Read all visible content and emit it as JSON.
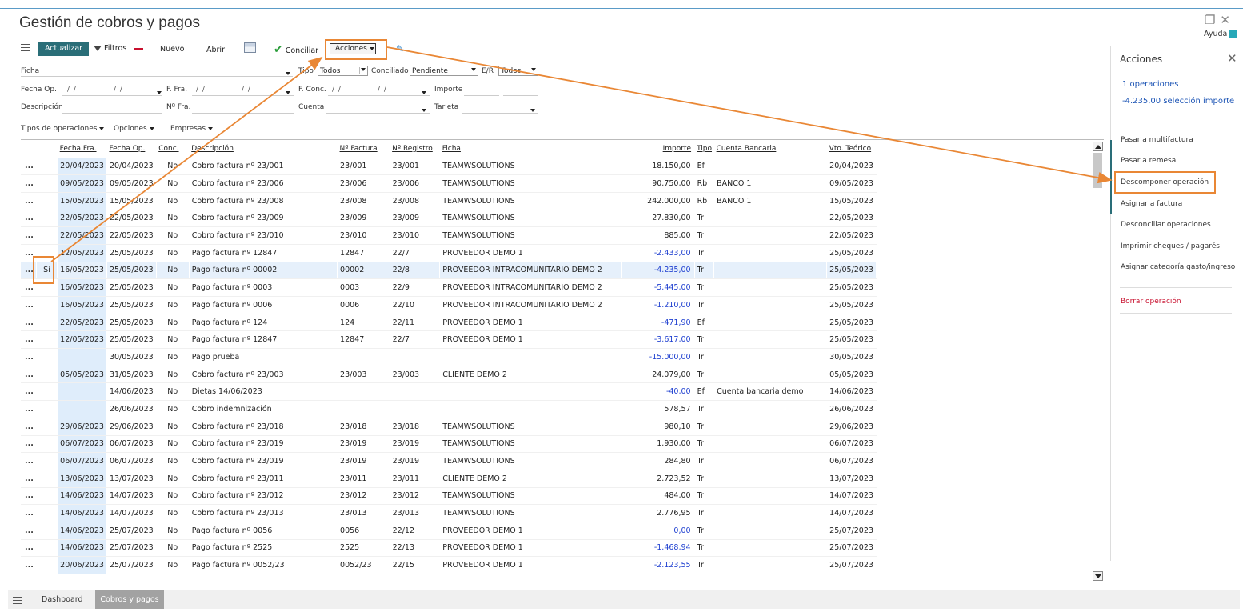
{
  "app": {
    "title": "Gestión de cobros y pagos",
    "help": "Ayuda"
  },
  "toolbar": {
    "actualizar": "Actualizar",
    "filtros": "Filtros",
    "nuevo": "Nuevo",
    "abrir": "Abrir",
    "conciliar": "Conciliar",
    "acciones": "Acciones"
  },
  "filters": {
    "ficha_label": "Ficha",
    "tipo_label": "Tipo",
    "tipo_value": "Todos",
    "conciliado_label": "Conciliado",
    "conciliado_value": "Pendiente",
    "er_label": "E/R",
    "er_value": "Todos",
    "fecha_op_label": "Fecha Op.",
    "fecha_fra_label": "F. Fra.",
    "f_conc_label": "F. Conc.",
    "importe_label": "Importe",
    "date_placeholder": "/ /",
    "descripcion_label": "Descripción",
    "nfra_label": "Nº Fra.",
    "cuenta_label": "Cuenta",
    "tarjeta_label": "Tarjeta",
    "dropdowns": [
      "Tipos de operaciones",
      "Opciones",
      "Empresas"
    ]
  },
  "table": {
    "headers": {
      "fecha_fra": "Fecha Fra.",
      "fecha_op": "Fecha Op.",
      "conc": "Conc.",
      "descripcion": "Descripción",
      "n_factura": "Nº Factura",
      "n_registro": "Nº Registro",
      "ficha": "Ficha",
      "importe": "Importe",
      "tipo": "Tipo",
      "cuenta_bancaria": "Cuenta Bancaria",
      "vto_teorico": "Vto. Teórico"
    },
    "rows": [
      {
        "dots": "...",
        "sel": "",
        "fra": "20/04/2023",
        "op": "20/04/2023",
        "conc": "No",
        "desc": "Cobro factura nº 23/001",
        "nfac": "23/001",
        "nreg": "23/001",
        "ficha": "TEAMWSOLUTIONS",
        "imp": "18.150,00",
        "tipo": "Ef",
        "cuenta": "",
        "vto": "20/04/2023"
      },
      {
        "dots": "...",
        "sel": "",
        "fra": "09/05/2023",
        "op": "09/05/2023",
        "conc": "No",
        "desc": "Cobro factura nº 23/006",
        "nfac": "23/006",
        "nreg": "23/006",
        "ficha": "TEAMWSOLUTIONS",
        "imp": "90.750,00",
        "tipo": "Rb",
        "cuenta": "BANCO 1",
        "vto": "09/05/2023"
      },
      {
        "dots": "...",
        "sel": "",
        "fra": "15/05/2023",
        "op": "15/05/2023",
        "conc": "No",
        "desc": "Cobro factura nº 23/008",
        "nfac": "23/008",
        "nreg": "23/008",
        "ficha": "TEAMWSOLUTIONS",
        "imp": "242.000,00",
        "tipo": "Rb",
        "cuenta": "BANCO 1",
        "vto": "15/05/2023"
      },
      {
        "dots": "...",
        "sel": "",
        "fra": "22/05/2023",
        "op": "22/05/2023",
        "conc": "No",
        "desc": "Cobro factura nº 23/009",
        "nfac": "23/009",
        "nreg": "23/009",
        "ficha": "TEAMWSOLUTIONS",
        "imp": "27.830,00",
        "tipo": "Tr",
        "cuenta": "",
        "vto": "22/05/2023"
      },
      {
        "dots": "...",
        "sel": "",
        "fra": "22/05/2023",
        "op": "22/05/2023",
        "conc": "No",
        "desc": "Cobro factura nº 23/010",
        "nfac": "23/010",
        "nreg": "23/010",
        "ficha": "TEAMWSOLUTIONS",
        "imp": "885,00",
        "tipo": "Tr",
        "cuenta": "",
        "vto": "22/05/2023"
      },
      {
        "dots": "...",
        "sel": "",
        "fra": "12/05/2023",
        "op": "25/05/2023",
        "conc": "No",
        "desc": "Pago factura nº 12847",
        "nfac": "12847",
        "nreg": "22/7",
        "ficha": "PROVEEDOR DEMO 1",
        "imp": "-2.433,00",
        "tipo": "Tr",
        "cuenta": "",
        "vto": "25/05/2023"
      },
      {
        "dots": "...",
        "sel": "Si",
        "fra": "16/05/2023",
        "op": "25/05/2023",
        "conc": "No",
        "desc": "Pago factura nº 00002",
        "nfac": "00002",
        "nreg": "22/8",
        "ficha": "PROVEEDOR INTRACOMUNITARIO DEMO 2",
        "imp": "-4.235,00",
        "tipo": "Tr",
        "cuenta": "",
        "vto": "25/05/2023"
      },
      {
        "dots": "...",
        "sel": "",
        "fra": "16/05/2023",
        "op": "25/05/2023",
        "conc": "No",
        "desc": "Pago factura nº 0003",
        "nfac": "0003",
        "nreg": "22/9",
        "ficha": "PROVEEDOR INTRACOMUNITARIO DEMO 2",
        "imp": "-5.445,00",
        "tipo": "Tr",
        "cuenta": "",
        "vto": "25/05/2023"
      },
      {
        "dots": "...",
        "sel": "",
        "fra": "16/05/2023",
        "op": "25/05/2023",
        "conc": "No",
        "desc": "Pago factura nº 0006",
        "nfac": "0006",
        "nreg": "22/10",
        "ficha": "PROVEEDOR INTRACOMUNITARIO DEMO 2",
        "imp": "-1.210,00",
        "tipo": "Tr",
        "cuenta": "",
        "vto": "25/05/2023"
      },
      {
        "dots": "...",
        "sel": "",
        "fra": "22/05/2023",
        "op": "25/05/2023",
        "conc": "No",
        "desc": "Pago factura nº 124",
        "nfac": "124",
        "nreg": "22/11",
        "ficha": "PROVEEDOR DEMO 1",
        "imp": "-471,90",
        "tipo": "Ef",
        "cuenta": "",
        "vto": "25/05/2023"
      },
      {
        "dots": "...",
        "sel": "",
        "fra": "12/05/2023",
        "op": "25/05/2023",
        "conc": "No",
        "desc": "Pago factura nº 12847",
        "nfac": "12847",
        "nreg": "22/7",
        "ficha": "PROVEEDOR DEMO 1",
        "imp": "-3.617,00",
        "tipo": "Tr",
        "cuenta": "",
        "vto": "25/05/2023"
      },
      {
        "dots": "...",
        "sel": "",
        "fra": "",
        "op": "30/05/2023",
        "conc": "No",
        "desc": "Pago prueba",
        "nfac": "",
        "nreg": "",
        "ficha": "",
        "imp": "-15.000,00",
        "tipo": "Tr",
        "cuenta": "",
        "vto": "30/05/2023"
      },
      {
        "dots": "...",
        "sel": "",
        "fra": "05/05/2023",
        "op": "31/05/2023",
        "conc": "No",
        "desc": "Cobro factura nº 23/003",
        "nfac": "23/003",
        "nreg": "23/003",
        "ficha": "CLIENTE DEMO 2",
        "imp": "24.079,00",
        "tipo": "Tr",
        "cuenta": "",
        "vto": "05/05/2023"
      },
      {
        "dots": "...",
        "sel": "",
        "fra": "",
        "op": "14/06/2023",
        "conc": "No",
        "desc": "Dietas 14/06/2023",
        "nfac": "",
        "nreg": "",
        "ficha": "",
        "imp": "-40,00",
        "tipo": "Ef",
        "cuenta": "Cuenta bancaria demo",
        "vto": "14/06/2023"
      },
      {
        "dots": "...",
        "sel": "",
        "fra": "",
        "op": "26/06/2023",
        "conc": "No",
        "desc": "Cobro indemnización",
        "nfac": "",
        "nreg": "",
        "ficha": "",
        "imp": "578,57",
        "tipo": "Tr",
        "cuenta": "",
        "vto": "26/06/2023"
      },
      {
        "dots": "...",
        "sel": "",
        "fra": "29/06/2023",
        "op": "29/06/2023",
        "conc": "No",
        "desc": "Cobro factura nº 23/018",
        "nfac": "23/018",
        "nreg": "23/018",
        "ficha": "TEAMWSOLUTIONS",
        "imp": "980,10",
        "tipo": "Tr",
        "cuenta": "",
        "vto": "29/06/2023"
      },
      {
        "dots": "...",
        "sel": "",
        "fra": "06/07/2023",
        "op": "06/07/2023",
        "conc": "No",
        "desc": "Cobro factura nº 23/019",
        "nfac": "23/019",
        "nreg": "23/019",
        "ficha": "TEAMWSOLUTIONS",
        "imp": "1.930,00",
        "tipo": "Tr",
        "cuenta": "",
        "vto": "06/07/2023"
      },
      {
        "dots": "...",
        "sel": "",
        "fra": "06/07/2023",
        "op": "06/07/2023",
        "conc": "No",
        "desc": "Cobro factura nº 23/019",
        "nfac": "23/019",
        "nreg": "23/019",
        "ficha": "TEAMWSOLUTIONS",
        "imp": "284,80",
        "tipo": "Tr",
        "cuenta": "",
        "vto": "06/07/2023"
      },
      {
        "dots": "...",
        "sel": "",
        "fra": "13/06/2023",
        "op": "13/07/2023",
        "conc": "No",
        "desc": "Cobro factura nº 23/011",
        "nfac": "23/011",
        "nreg": "23/011",
        "ficha": "CLIENTE DEMO 2",
        "imp": "2.723,52",
        "tipo": "Tr",
        "cuenta": "",
        "vto": "13/07/2023"
      },
      {
        "dots": "...",
        "sel": "",
        "fra": "14/06/2023",
        "op": "14/07/2023",
        "conc": "No",
        "desc": "Cobro factura nº 23/012",
        "nfac": "23/012",
        "nreg": "23/012",
        "ficha": "TEAMWSOLUTIONS",
        "imp": "484,00",
        "tipo": "Tr",
        "cuenta": "",
        "vto": "14/07/2023"
      },
      {
        "dots": "...",
        "sel": "",
        "fra": "14/06/2023",
        "op": "14/07/2023",
        "conc": "No",
        "desc": "Cobro factura nº 23/013",
        "nfac": "23/013",
        "nreg": "23/013",
        "ficha": "TEAMWSOLUTIONS",
        "imp": "2.776,95",
        "tipo": "Tr",
        "cuenta": "",
        "vto": "14/07/2023"
      },
      {
        "dots": "...",
        "sel": "",
        "fra": "14/06/2023",
        "op": "25/07/2023",
        "conc": "No",
        "desc": "Pago factura nº 0056",
        "nfac": "0056",
        "nreg": "22/12",
        "ficha": "PROVEEDOR DEMO 1",
        "imp": "0,00",
        "tipo": "Tr",
        "cuenta": "",
        "vto": "25/07/2023"
      },
      {
        "dots": "...",
        "sel": "",
        "fra": "14/06/2023",
        "op": "25/07/2023",
        "conc": "No",
        "desc": "Pago factura nº 2525",
        "nfac": "2525",
        "nreg": "22/13",
        "ficha": "PROVEEDOR DEMO 1",
        "imp": "-1.468,94",
        "tipo": "Tr",
        "cuenta": "",
        "vto": "25/07/2023"
      },
      {
        "dots": "...",
        "sel": "",
        "fra": "20/06/2023",
        "op": "25/07/2023",
        "conc": "No",
        "desc": "Pago factura nº 0052/23",
        "nfac": "0052/23",
        "nreg": "22/15",
        "ficha": "PROVEEDOR DEMO 1",
        "imp": "-2.123,55",
        "tipo": "Tr",
        "cuenta": "",
        "vto": "25/07/2023"
      }
    ]
  },
  "panel": {
    "title": "Acciones",
    "count": "1 operaciones",
    "selection": "-4.235,00 selección importe",
    "actions": [
      "Pasar a multifactura",
      "Pasar a remesa",
      "Descomponer operación",
      "Asignar a factura",
      "Desconciliar operaciones",
      "Imprimir cheques / pagarés",
      "Asignar categoría gasto/ingreso"
    ],
    "delete": "Borrar operación"
  },
  "bottom": {
    "tabs": [
      "Dashboard",
      "Cobros y pagos"
    ]
  },
  "colors": {
    "accent": "#2a6e78",
    "highlight": "#e98735",
    "negative": "#1e3fd0",
    "delete": "#c8102e"
  }
}
